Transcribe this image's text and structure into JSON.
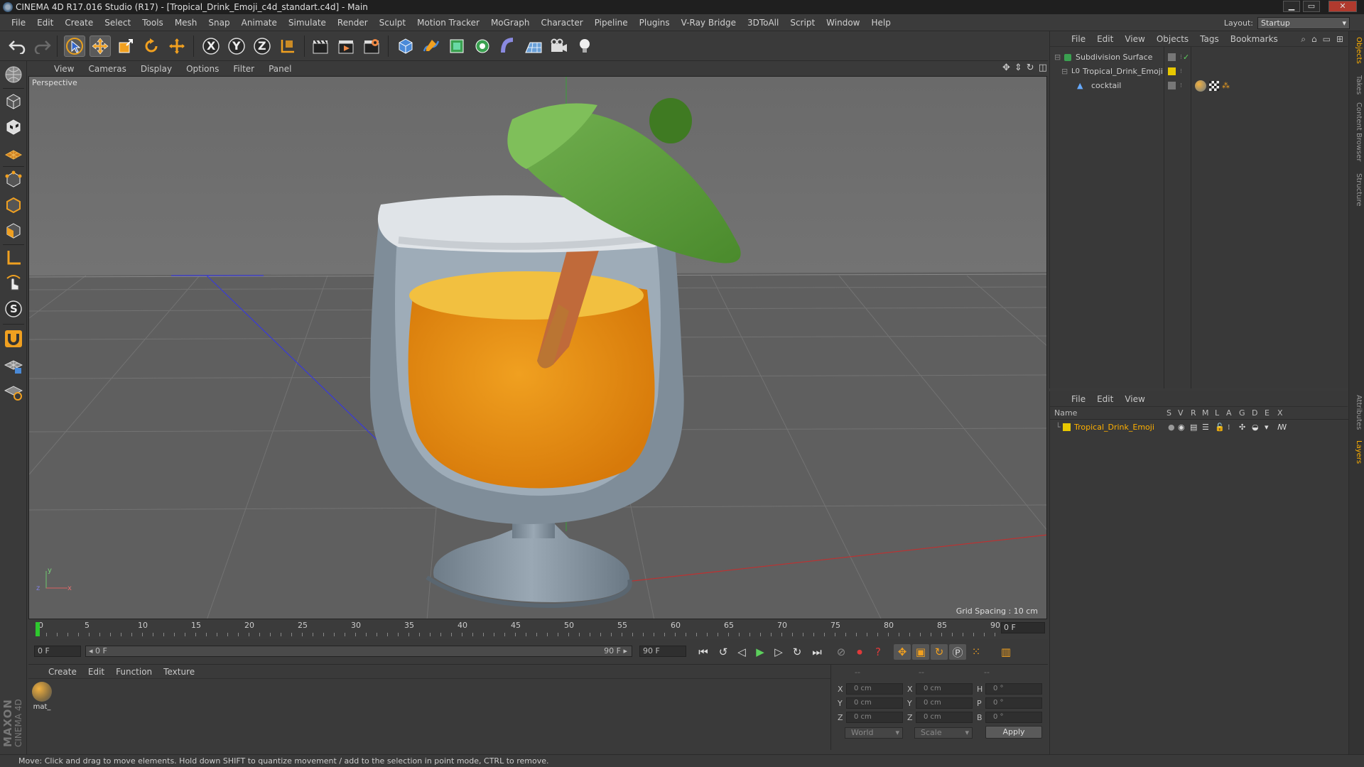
{
  "window": {
    "title": "CINEMA 4D R17.016 Studio (R17) - [Tropical_Drink_Emoji_c4d_standart.c4d] - Main",
    "minimize": "▁",
    "maximize": "▭",
    "close": "✕"
  },
  "menubar": [
    "File",
    "Edit",
    "Create",
    "Select",
    "Tools",
    "Mesh",
    "Snap",
    "Animate",
    "Simulate",
    "Render",
    "Sculpt",
    "Motion Tracker",
    "MoGraph",
    "Character",
    "Pipeline",
    "Plugins",
    "V-Ray Bridge",
    "3DToAll",
    "Script",
    "Window",
    "Help"
  ],
  "layout": {
    "label": "Layout:",
    "value": "Startup"
  },
  "toolbar": {
    "axis_x": "X",
    "axis_y": "Y",
    "axis_z": "Z"
  },
  "left_tools": {
    "snap_letter": "S"
  },
  "viewport": {
    "menu": [
      "View",
      "Cameras",
      "Display",
      "Options",
      "Filter",
      "Panel"
    ],
    "label": "Perspective",
    "grid_spacing": "Grid Spacing : 10 cm",
    "axis_y": "y",
    "axis_z": "z",
    "axis_x": "x"
  },
  "timeline": {
    "ticks": [
      "0",
      "5",
      "10",
      "15",
      "20",
      "25",
      "30",
      "35",
      "40",
      "45",
      "50",
      "55",
      "60",
      "65",
      "70",
      "75",
      "80",
      "85",
      "90"
    ],
    "current": "0 F",
    "current_fraction": 0.0
  },
  "transport": {
    "start": "0 F",
    "slider_start": "◂ 0 F",
    "slider_end": "90 F ▸",
    "end": "90 F"
  },
  "material": {
    "menu": [
      "Create",
      "Edit",
      "Function",
      "Texture"
    ],
    "items": [
      {
        "name": "mat_"
      }
    ]
  },
  "coords": {
    "head_left": "--",
    "head_mid": "--",
    "head_right": "--",
    "rows": [
      {
        "a": "X",
        "av": "0 cm",
        "b": "X",
        "bv": "0 cm",
        "c": "H",
        "cv": "0 °"
      },
      {
        "a": "Y",
        "av": "0 cm",
        "b": "Y",
        "bv": "0 cm",
        "c": "P",
        "cv": "0 °"
      },
      {
        "a": "Z",
        "av": "0 cm",
        "b": "Z",
        "bv": "0 cm",
        "c": "B",
        "cv": "0 °"
      }
    ],
    "space": "World",
    "mode": "Scale",
    "apply": "Apply"
  },
  "objects": {
    "menu": [
      "File",
      "Edit",
      "View",
      "Objects",
      "Tags",
      "Bookmarks"
    ],
    "items": [
      {
        "name": "Subdivision Surface",
        "icon": "subdivision-icon"
      },
      {
        "name": "Tropical_Drink_Emoji",
        "icon": "null-icon"
      },
      {
        "name": "cocktail",
        "icon": "polygon-icon"
      }
    ]
  },
  "layers": {
    "menu": [
      "File",
      "Edit",
      "View"
    ],
    "columns": [
      "Name",
      "S",
      "V",
      "R",
      "M",
      "L",
      "A",
      "G",
      "D",
      "E",
      "X"
    ],
    "items": [
      {
        "name": "Tropical_Drink_Emoji",
        "color": "#e8c800"
      }
    ]
  },
  "right_tabs": [
    "Objects",
    "Takes",
    "Content Browser",
    "Structure",
    "Attributes",
    "Layers"
  ],
  "status": "Move: Click and drag to move elements. Hold down SHIFT to quantize movement / add to the selection in point mode, CTRL to remove.",
  "branding": {
    "maxon": "MAXON",
    "product": "CINEMA 4D"
  },
  "colors": {
    "accent": "#ffb000",
    "liquid": "#e8850e",
    "umbrella": "#5e9e3c",
    "glass": "#8c9aa6"
  }
}
